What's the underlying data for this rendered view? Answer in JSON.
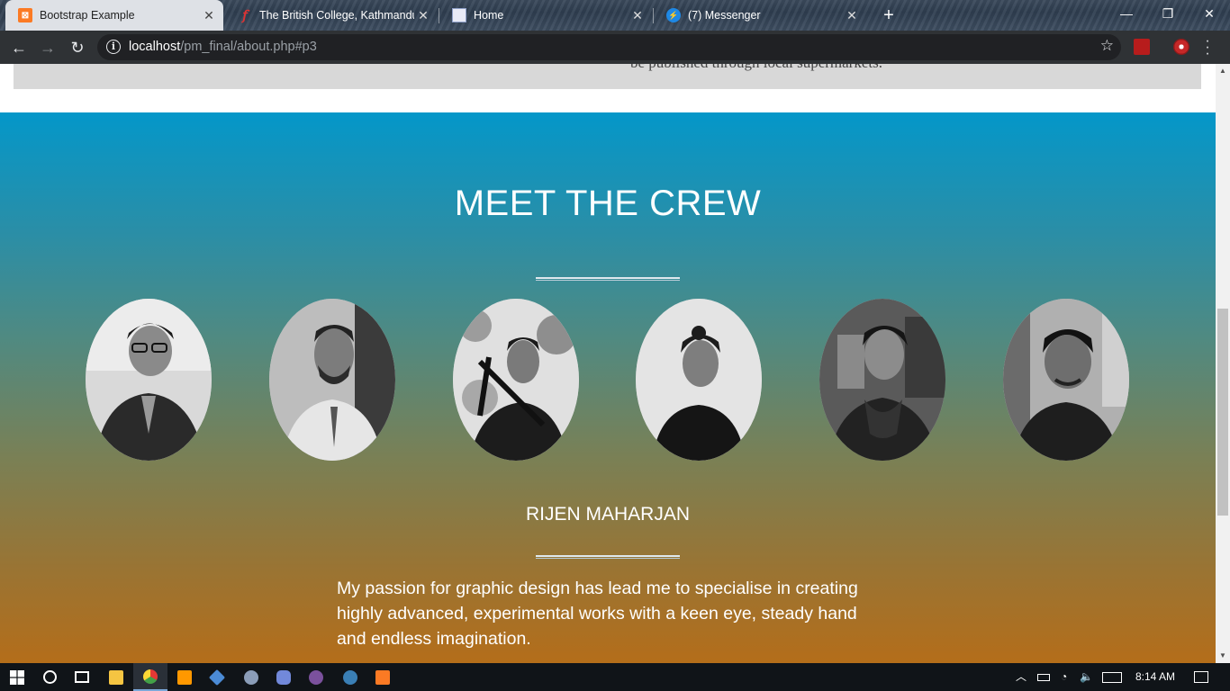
{
  "browser": {
    "tabs": [
      {
        "title": "Bootstrap Example",
        "active": true,
        "favicon": "xampp-icon"
      },
      {
        "title": "The British College, Kathmandu :",
        "active": false,
        "favicon": "college-icon"
      },
      {
        "title": "Home",
        "active": false,
        "favicon": "page-icon"
      },
      {
        "title": "(7) Messenger",
        "active": false,
        "favicon": "messenger-icon"
      }
    ],
    "url_host": "localhost",
    "url_path": "/pm_final/about.php#p3"
  },
  "page": {
    "cut_off_text": "be published through local supermarkets.",
    "crew_title": "MEET THE CREW",
    "members": [
      {
        "name": "member-1"
      },
      {
        "name": "member-2"
      },
      {
        "name": "member-3"
      },
      {
        "name": "member-4"
      },
      {
        "name": "member-5"
      },
      {
        "name": "member-6"
      }
    ],
    "selected_member_name": "RIJEN MAHARJAN",
    "selected_member_bio": "My passion for graphic design has lead me to specialise in creating highly advanced, experimental works with a keen eye, steady hand and endless imagination."
  },
  "taskbar": {
    "apps": [
      "start-icon",
      "cortana-icon",
      "task-view-icon",
      "file-explorer-icon",
      "chrome-icon",
      "sublime-text-icon",
      "network-app-icon",
      "vlc-icon",
      "discord-icon",
      "viber-icon",
      "steam-icon",
      "xampp-icon"
    ],
    "clock": "8:14 AM"
  }
}
